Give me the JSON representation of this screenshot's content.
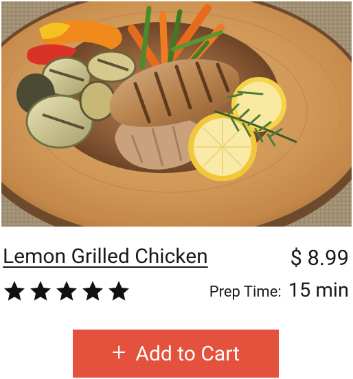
{
  "product": {
    "title": "Lemon Grilled Chicken",
    "price": "$ 8.99",
    "rating": 5,
    "rating_max": 5,
    "prep_label": "Prep Time:",
    "prep_value": "15 min",
    "image_icon": "grilled-chicken-plate-photo"
  },
  "cart": {
    "add_icon": "+",
    "add_label": "Add to Cart"
  },
  "colors": {
    "button": "#e4513c",
    "text": "#1a1a1a",
    "star": "#111111"
  }
}
